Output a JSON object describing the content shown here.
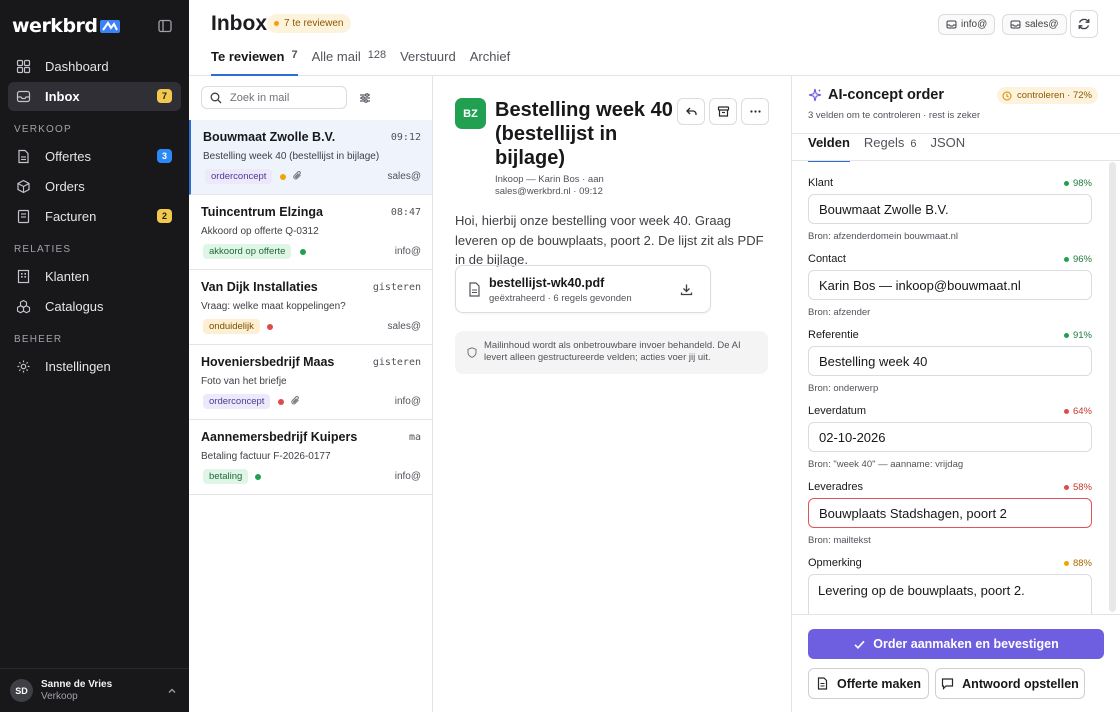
{
  "sidebar": {
    "logo": "werkbrd",
    "items": [
      {
        "label": "Dashboard",
        "icon": "dashboard-icon"
      },
      {
        "label": "Inbox",
        "icon": "inbox-icon",
        "count": "7"
      }
    ],
    "sections": [
      {
        "title": "VERKOOP",
        "items": [
          {
            "label": "Offertes",
            "icon": "document-icon",
            "count": "3"
          },
          {
            "label": "Orders",
            "icon": "box-icon"
          },
          {
            "label": "Facturen",
            "icon": "receipt-icon",
            "count": "2"
          }
        ]
      },
      {
        "title": "RELATIES",
        "items": [
          {
            "label": "Klanten",
            "icon": "building-icon"
          },
          {
            "label": "Catalogus",
            "icon": "catalog-icon"
          }
        ]
      },
      {
        "title": "BEHEER",
        "items": [
          {
            "label": "Instellingen",
            "icon": "gear-icon"
          }
        ]
      }
    ],
    "user": {
      "initials": "SD",
      "name": "Sanne de Vries",
      "role": "Verkoop"
    }
  },
  "header": {
    "title": "Inbox",
    "review_badge": "7 te reviewen",
    "tabs": [
      {
        "label": "Te reviewen",
        "count": "7"
      },
      {
        "label": "Alle mail",
        "count": "128"
      },
      {
        "label": "Verstuurd",
        "count": ""
      },
      {
        "label": "Archief",
        "count": ""
      }
    ],
    "accounts": [
      "info@",
      "sales@"
    ]
  },
  "list": {
    "search_placeholder": "Zoek in mail",
    "mails": [
      {
        "from": "Bouwmaat Zwolle B.V.",
        "time": "09:12",
        "subject": "Bestelling week 40 (bestellijst in bijlage)",
        "tag": "orderconcept",
        "to": "sales@"
      },
      {
        "from": "Tuincentrum Elzinga",
        "time": "08:47",
        "subject": "Akkoord op offerte Q-0312",
        "tag": "akkoord op offerte",
        "to": "info@"
      },
      {
        "from": "Van Dijk Installaties",
        "time": "gisteren",
        "subject": "Vraag: welke maat koppelingen?",
        "tag": "onduidelijk",
        "to": "sales@"
      },
      {
        "from": "Hoveniersbedrijf Maas",
        "time": "gisteren",
        "subject": "Foto van het briefje",
        "tag": "orderconcept",
        "to": "info@"
      },
      {
        "from": "Aannemersbedrijf Kuipers",
        "time": "ma",
        "subject": "Betaling factuur F-2026-0177",
        "tag": "betaling",
        "to": "info@"
      }
    ]
  },
  "reader": {
    "avatar": "BZ",
    "title": "Bestelling week 40 (bestellijst in bijlage)",
    "meta": "Inkoop — Karin Bos · aan sales@werkbrd.nl · 09:12",
    "body": "Hoi, hierbij onze bestelling voor week 40. Graag leveren op de bouwplaats, poort 2. De lijst zit als PDF in de bijlage.",
    "attachment": {
      "name": "bestellijst-wk40.pdf",
      "info": "geëxtraheerd · 6 regels gevonden"
    },
    "notice": "Mailinhoud wordt als onbetrouwbare invoer behandeld. De AI levert alleen gestructureerde velden; acties voer jij uit."
  },
  "ai": {
    "title": "AI-concept order",
    "subtitle": "3 velden om te controleren · rest is zeker",
    "badge": "controleren · 72%",
    "tabs": [
      {
        "label": "Velden",
        "count": ""
      },
      {
        "label": "Regels",
        "count": "6"
      },
      {
        "label": "JSON",
        "count": ""
      }
    ],
    "fields": [
      {
        "label": "Klant",
        "confidence": "98%",
        "value": "Bouwmaat Zwolle B.V.",
        "source": "Bron: afzenderdomein bouwmaat.nl"
      },
      {
        "label": "Contact",
        "confidence": "96%",
        "value": "Karin Bos — inkoop@bouwmaat.nl",
        "source": "Bron: afzender"
      },
      {
        "label": "Referentie",
        "confidence": "91%",
        "value": "Bestelling week 40",
        "source": "Bron: onderwerp"
      },
      {
        "label": "Leverdatum",
        "confidence": "64%",
        "value": "02-10-2026",
        "source": "Bron: \"week 40\" — aanname: vrijdag"
      },
      {
        "label": "Leveradres",
        "confidence": "58%",
        "value": "Bouwplaats Stadshagen, poort 2",
        "source": "Bron: mailtekst"
      },
      {
        "label": "Opmerking",
        "confidence": "88%",
        "value": "Levering op de bouwplaats, poort 2.",
        "source": ""
      }
    ],
    "primary_button": "Order aanmaken en bevestigen",
    "quote_button": "Offerte maken",
    "reply_button": "Antwoord opstellen"
  },
  "colors": {
    "accent": "#2b6fd6",
    "primary": "#6e5fe0",
    "sidebar": "#18181b",
    "ok": "#22a052",
    "warn": "#e04a4a",
    "amber": "#f0a500"
  }
}
